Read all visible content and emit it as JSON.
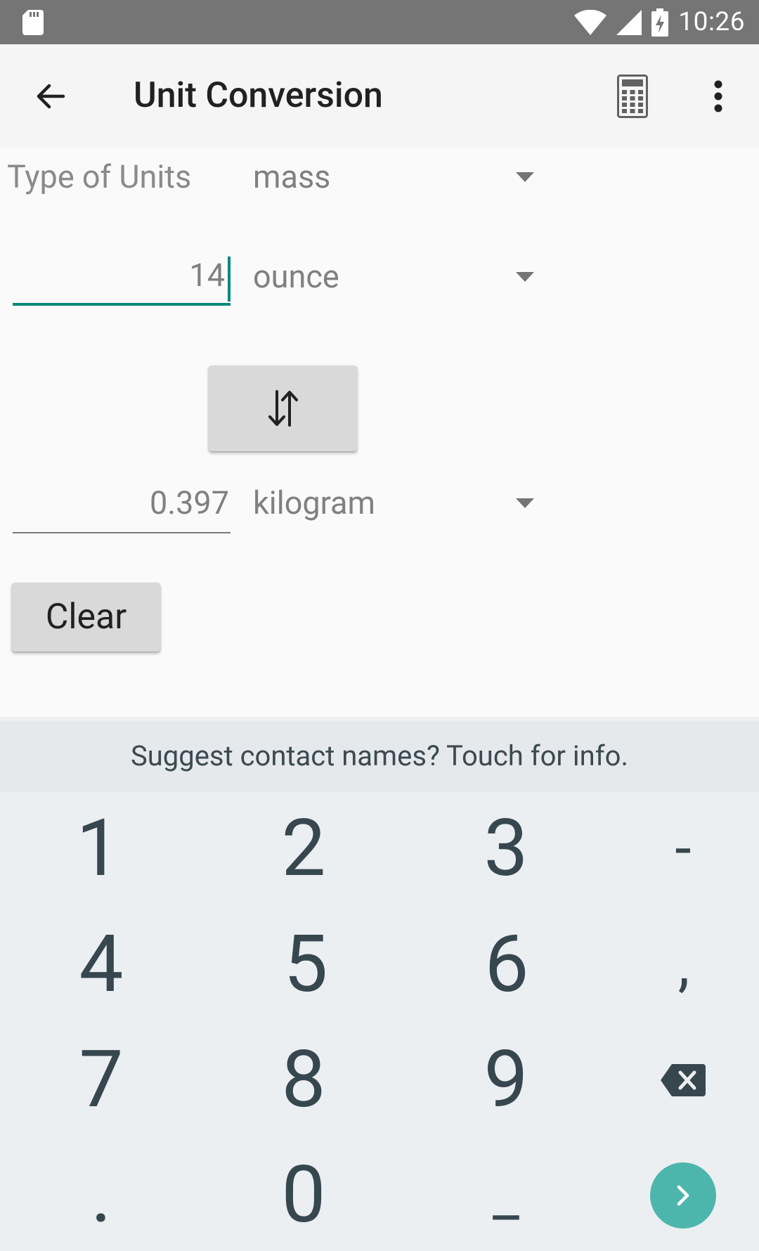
{
  "status_bar": {
    "time": "10:26"
  },
  "app_bar": {
    "title": "Unit Conversion"
  },
  "form": {
    "type_label": "Type of Units",
    "type_value": "mass",
    "input_value": "14",
    "input_unit": "ounce",
    "output_value": "0.397",
    "output_unit": "kilogram",
    "clear_label": "Clear"
  },
  "keyboard": {
    "suggestion": "Suggest contact names? Touch for info.",
    "rows": [
      [
        "1",
        "2",
        "3",
        "-"
      ],
      [
        "4",
        "5",
        "6",
        ","
      ],
      [
        "7",
        "8",
        "9"
      ],
      [
        ".",
        "0",
        "_"
      ]
    ]
  },
  "colors": {
    "accent": "#00897b",
    "enter_key": "#4db6ac",
    "status_bar": "#757575"
  }
}
